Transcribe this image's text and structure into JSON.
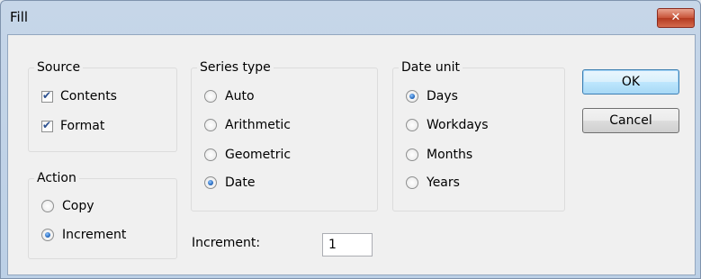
{
  "window": {
    "title": "Fill",
    "close_symbol": "✕"
  },
  "source": {
    "label": "Source",
    "items": [
      {
        "label": "Contents",
        "checked": true
      },
      {
        "label": "Format",
        "checked": true
      }
    ]
  },
  "action": {
    "label": "Action",
    "items": [
      {
        "label": "Copy",
        "selected": false
      },
      {
        "label": "Increment",
        "selected": true
      }
    ]
  },
  "series_type": {
    "label": "Series type",
    "items": [
      {
        "label": "Auto",
        "selected": false
      },
      {
        "label": "Arithmetic",
        "selected": false
      },
      {
        "label": "Geometric",
        "selected": false
      },
      {
        "label": "Date",
        "selected": true
      }
    ]
  },
  "date_unit": {
    "label": "Date unit",
    "items": [
      {
        "label": "Days",
        "selected": true
      },
      {
        "label": "Workdays",
        "selected": false
      },
      {
        "label": "Months",
        "selected": false
      },
      {
        "label": "Years",
        "selected": false
      }
    ]
  },
  "buttons": {
    "ok": "OK",
    "cancel": "Cancel"
  },
  "increment": {
    "label": "Increment:",
    "value": "1"
  },
  "colors": {
    "title_bg": "#c6d6e8",
    "close_button": "#c75338",
    "default_button": "#a7d9f5"
  }
}
